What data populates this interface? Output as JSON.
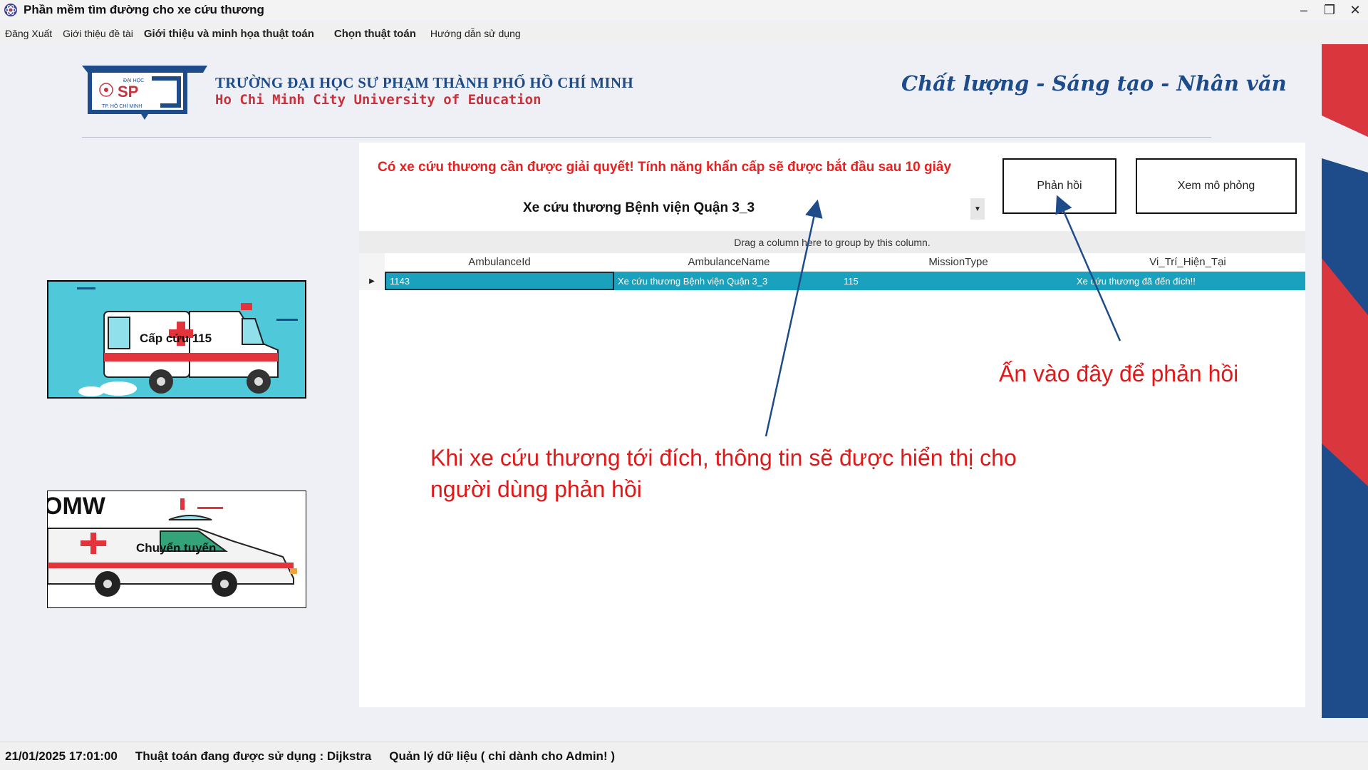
{
  "window": {
    "title": "Phần mềm tìm đường cho xe cứu thương",
    "app_icon": "atom-icon",
    "controls": {
      "minimize": "–",
      "restore": "❐",
      "close": "✕"
    }
  },
  "menu": {
    "items": [
      {
        "label": "Đăng Xuất",
        "bold": false
      },
      {
        "label": "Giới thiệu đề tài",
        "bold": false
      },
      {
        "label": "Giới thiệu và minh họa thuật toán",
        "bold": true
      },
      {
        "label": "Chọn thuật toán",
        "bold": true
      },
      {
        "label": "Hướng dẫn sử dụng",
        "bold": false
      }
    ]
  },
  "header": {
    "logo": {
      "top_text": "ĐẠI HỌC",
      "main_text": "SP",
      "bottom_text": "TP. HỒ CHÍ MINH"
    },
    "university_vn": "TRƯỜNG ĐẠI HỌC SƯ PHẠM THÀNH PHỐ HỒ CHÍ MINH",
    "university_en": "Ho Chi Minh City University of Education",
    "motto": "Chất lượng - Sáng tạo - Nhân văn"
  },
  "cards": [
    {
      "label": "Cấp cứu 115"
    },
    {
      "label": "Chuyển tuyến",
      "vehicle_text": "OMW"
    }
  ],
  "panel": {
    "alert": "Có xe cứu thương cần được giải quyết! Tính năng khẩn cấp sẽ được bắt đầu sau 10 giây",
    "combo_value": "Xe cứu thương Bệnh viện Quận 3_3",
    "feedback_button": "Phản hồi",
    "simulate_button": "Xem mô phỏng"
  },
  "grid": {
    "group_panel_text": "Drag a column here to group by this column.",
    "columns": [
      "AmbulanceId",
      "AmbulanceName",
      "MissionType",
      "Vi_Trí_Hiện_Tại"
    ],
    "rows": [
      [
        "1143",
        "Xe cứu thương Bệnh viện Quận 3_3",
        "115",
        "Xe cứu thương đã đến đích!!"
      ]
    ]
  },
  "annotations": {
    "feedback_hint": "Ấn vào đây để phản hồi",
    "arrival_hint_line1": "Khi xe cứu thương tới đích, thông tin sẽ được hiển thị cho",
    "arrival_hint_line2": "người dùng phản hồi"
  },
  "status": {
    "datetime": "21/01/2025 17:01:00",
    "algorithm": "Thuật toán đang được sử dụng : Dijkstra",
    "admin": "Quản lý dữ liệu ( chỉ dành cho Admin! )"
  },
  "colors": {
    "alert": "#e32222",
    "selected_row": "#1aa1be",
    "brand_blue": "#1e4c8a",
    "brand_red": "#c8323c",
    "annotation": "#e01818"
  }
}
